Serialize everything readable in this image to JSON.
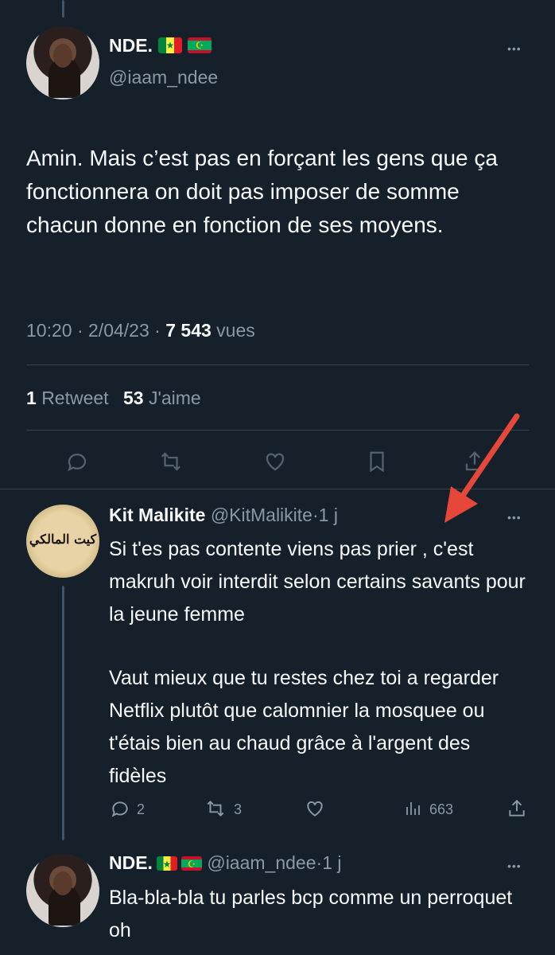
{
  "tweet1": {
    "name": "NDE.",
    "handle": "@iaam_ndee",
    "text": "Amin. Mais c’est pas en forçant les gens que ça fonctionnera on doit pas imposer de somme chacun donne en fonction de ses moyens.",
    "time": "10:20",
    "date": "2/04/23",
    "views_count": "7 543",
    "views_label": "vues",
    "retweet_count": "1",
    "retweet_label": "Retweet",
    "like_count": "53",
    "like_label": "J'aime",
    "more": "•••"
  },
  "reply1": {
    "name": "Kit Malikite",
    "handle": "@KitMalikite",
    "sep": "·",
    "age": "1 j",
    "avatar_text": "كيت المالكي",
    "more": "•••",
    "para1": "Si t'es pas contente viens pas prier , c'est makruh voir interdit selon certains savants pour la jeune femme",
    "para2": "Vaut mieux que tu restes chez toi a regarder Netflix plutôt que calomnier la mosquee ou t'étais bien au chaud grâce à l'argent des fidèles",
    "replies": "2",
    "retweets": "3",
    "views": "663"
  },
  "reply2": {
    "name": "NDE.",
    "handle": "@iaam_ndee",
    "sep": "·",
    "age": "1 j",
    "more": "•••",
    "text": "Bla-bla-bla tu parles bcp comme un perroquet oh"
  },
  "colors": {
    "background": "#15202b",
    "text": "#f7f9f9",
    "muted": "#8b98a5",
    "divider": "#38444d",
    "arrow": "#e5473b"
  },
  "icons": [
    "reply-icon",
    "retweet-icon",
    "like-icon",
    "bookmark-icon",
    "share-icon",
    "views-icon",
    "arrow-annotation"
  ]
}
